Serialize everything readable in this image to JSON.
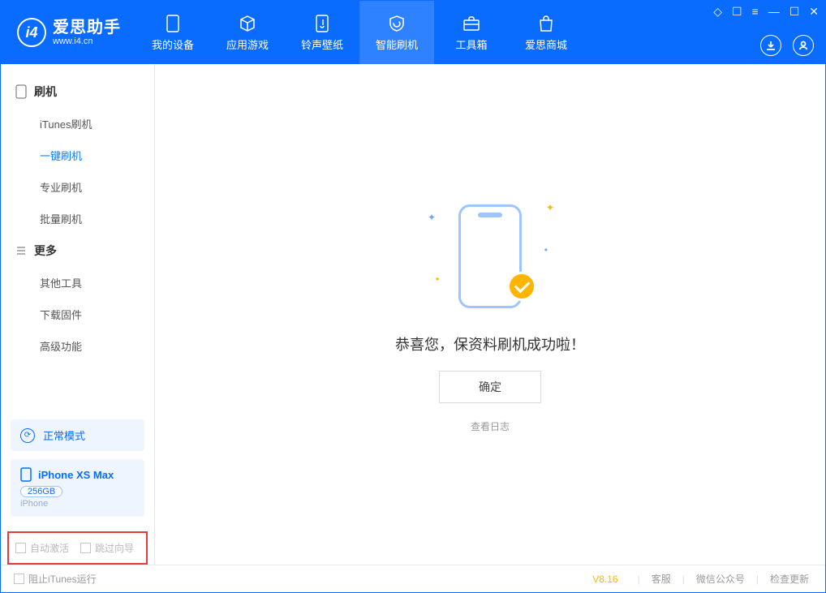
{
  "app": {
    "title": "爱思助手",
    "url": "www.i4.cn"
  },
  "header_tabs": {
    "device": "我的设备",
    "apps": "应用游戏",
    "ring": "铃声壁纸",
    "flash": "智能刷机",
    "tools": "工具箱",
    "store": "爱思商城"
  },
  "sidebar": {
    "group_flash": "刷机",
    "items_flash": {
      "itunes": "iTunes刷机",
      "onekey": "一键刷机",
      "pro": "专业刷机",
      "batch": "批量刷机"
    },
    "group_more": "更多",
    "items_more": {
      "other": "其他工具",
      "firmware": "下载固件",
      "advanced": "高级功能"
    }
  },
  "device_card": {
    "mode": "正常模式",
    "name": "iPhone XS Max",
    "capacity": "256GB",
    "type": "iPhone"
  },
  "checkboxes": {
    "auto_activate": "自动激活",
    "skip_guide": "跳过向导"
  },
  "main": {
    "success_msg": "恭喜您，保资料刷机成功啦！",
    "ok": "确定",
    "view_log": "查看日志"
  },
  "footer": {
    "block_itunes": "阻止iTunes运行",
    "version": "V8.16",
    "service": "客服",
    "wechat": "微信公众号",
    "update": "检查更新"
  }
}
